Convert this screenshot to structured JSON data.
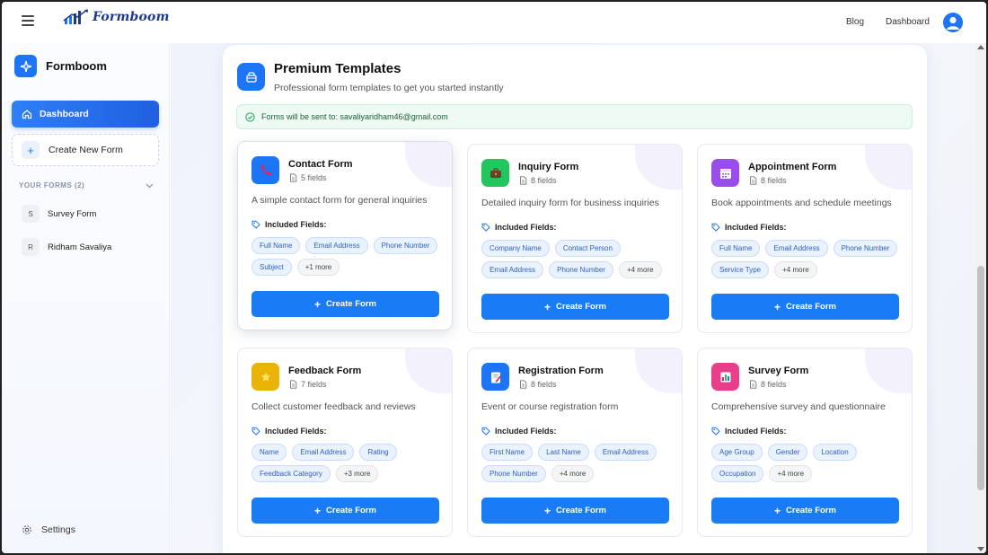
{
  "header": {
    "logo_text": "Formboom",
    "nav": [
      "Blog",
      "Dashboard"
    ]
  },
  "sidebar": {
    "brand": "Formboom",
    "dashboard_label": "Dashboard",
    "new_form_label": "Create New Form",
    "your_forms_label": "YOUR FORMS (2)",
    "forms": [
      {
        "initial": "S",
        "name": "Survey Form"
      },
      {
        "initial": "R",
        "name": "Ridham Savaliya"
      }
    ],
    "settings_label": "Settings"
  },
  "main": {
    "title": "Premium Templates",
    "subtitle": "Professional form templates to get you started instantly",
    "notice": "Forms will be sent to: savaliyaridham46@gmail.com",
    "included_label": "Included Fields:",
    "create_label": "Create Form",
    "templates": [
      {
        "icon": "phone-icon",
        "color": "#1d74f5",
        "title": "Contact Form",
        "fields": "5 fields",
        "desc": "A simple contact form for general inquiries",
        "chips": [
          "Full Name",
          "Email Address",
          "Phone Number",
          "Subject"
        ],
        "more": "+1 more"
      },
      {
        "icon": "briefcase-icon",
        "color": "#22c55e",
        "title": "Inquiry Form",
        "fields": "8 fields",
        "desc": "Detailed inquiry form for business inquiries",
        "chips": [
          "Company Name",
          "Contact Person",
          "Email Address",
          "Phone Number"
        ],
        "more": "+4 more"
      },
      {
        "icon": "calendar-icon",
        "color": "#9b4dea",
        "title": "Appointment Form",
        "fields": "8 fields",
        "desc": "Book appointments and schedule meetings",
        "chips": [
          "Full Name",
          "Email Address",
          "Phone Number",
          "Service Type"
        ],
        "more": "+4 more"
      },
      {
        "icon": "star-icon",
        "color": "#eab308",
        "title": "Feedback Form",
        "fields": "7 fields",
        "desc": "Collect customer feedback and reviews",
        "chips": [
          "Name",
          "Email Address",
          "Rating",
          "Feedback Category"
        ],
        "more": "+3 more"
      },
      {
        "icon": "clipboard-icon",
        "color": "#1d74f5",
        "title": "Registration Form",
        "fields": "8 fields",
        "desc": "Event or course registration form",
        "chips": [
          "First Name",
          "Last Name",
          "Email Address",
          "Phone Number"
        ],
        "more": "+4 more"
      },
      {
        "icon": "bar-chart-icon",
        "color": "#e83e8c",
        "title": "Survey Form",
        "fields": "8 fields",
        "desc": "Comprehensive survey and questionnaire",
        "chips": [
          "Age Group",
          "Gender",
          "Location",
          "Occupation"
        ],
        "more": "+4 more"
      }
    ]
  }
}
